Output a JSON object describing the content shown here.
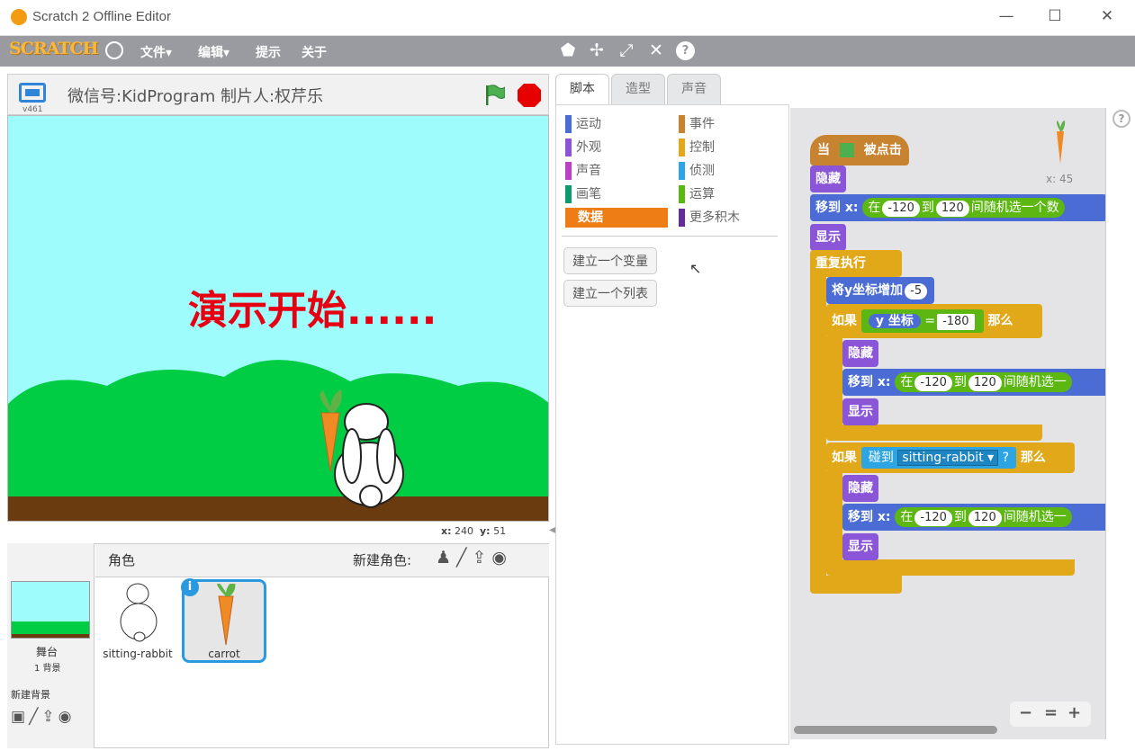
{
  "window": {
    "title": "Scratch 2 Offline Editor",
    "minimize": "—",
    "maximize": "☐",
    "close": "✕"
  },
  "menu": {
    "logo": "SCRATCH",
    "items": [
      "文件▾",
      "编辑▾",
      "提示",
      "关于"
    ],
    "globe_icon": "globe-icon",
    "tools": [
      "stamp-icon",
      "cut-icon",
      "grow-icon",
      "shrink-icon",
      "help-icon"
    ]
  },
  "stage": {
    "title": "微信号:KidProgram 制片人:权芹乐",
    "version": "v461",
    "banner_text": "演示开始......",
    "coords": {
      "x_label": "x:",
      "x": "240",
      "y_label": "y:",
      "y": "51"
    }
  },
  "sprites": {
    "header": "角色",
    "new_sprite_label": "新建角色:",
    "stage_label": "舞台",
    "stage_backdrops": "1 背景",
    "new_backdrop_label": "新建背景",
    "items": [
      {
        "name": "sitting-rabbit",
        "selected": false
      },
      {
        "name": "carrot",
        "selected": true
      }
    ]
  },
  "tabs": [
    "脚本",
    "造型",
    "声音"
  ],
  "palette": {
    "categories_left": [
      {
        "label": "运动",
        "color": "#4a6cd4"
      },
      {
        "label": "外观",
        "color": "#8a55d7"
      },
      {
        "label": "声音",
        "color": "#bb42c3"
      },
      {
        "label": "画笔",
        "color": "#0e9a6c"
      },
      {
        "label": "数据",
        "color": "#ee7d16"
      }
    ],
    "categories_right": [
      {
        "label": "事件",
        "color": "#c88330"
      },
      {
        "label": "控制",
        "color": "#e1a91a"
      },
      {
        "label": "侦测",
        "color": "#2ca5e2"
      },
      {
        "label": "运算",
        "color": "#5cb712"
      },
      {
        "label": "更多积木",
        "color": "#632d99"
      }
    ],
    "selected": "数据",
    "buttons": [
      "建立一个变量",
      "建立一个列表"
    ]
  },
  "script": {
    "hat": {
      "when": "当",
      "clicked": "被点击"
    },
    "hide": "隐藏",
    "show": "显示",
    "goto": "移到 x:",
    "in": "在",
    "to": "到",
    "rand_tail": "间随机选一个数",
    "rand_tail_short": "间随机选一",
    "neg120": "-120",
    "pos120": "120",
    "forever": "重复执行",
    "change_y": "将y坐标增加",
    "change_val": "-5",
    "if": "如果",
    "then": "那么",
    "ypos": "y 坐标",
    "eq": "=",
    "neg180": "-180",
    "touching": "碰到",
    "touch_target": "sitting-rabbit",
    "q": "?",
    "sprite_info": "x: 45"
  },
  "zoom": {
    "out": "−",
    "reset": "=",
    "in": "+"
  }
}
